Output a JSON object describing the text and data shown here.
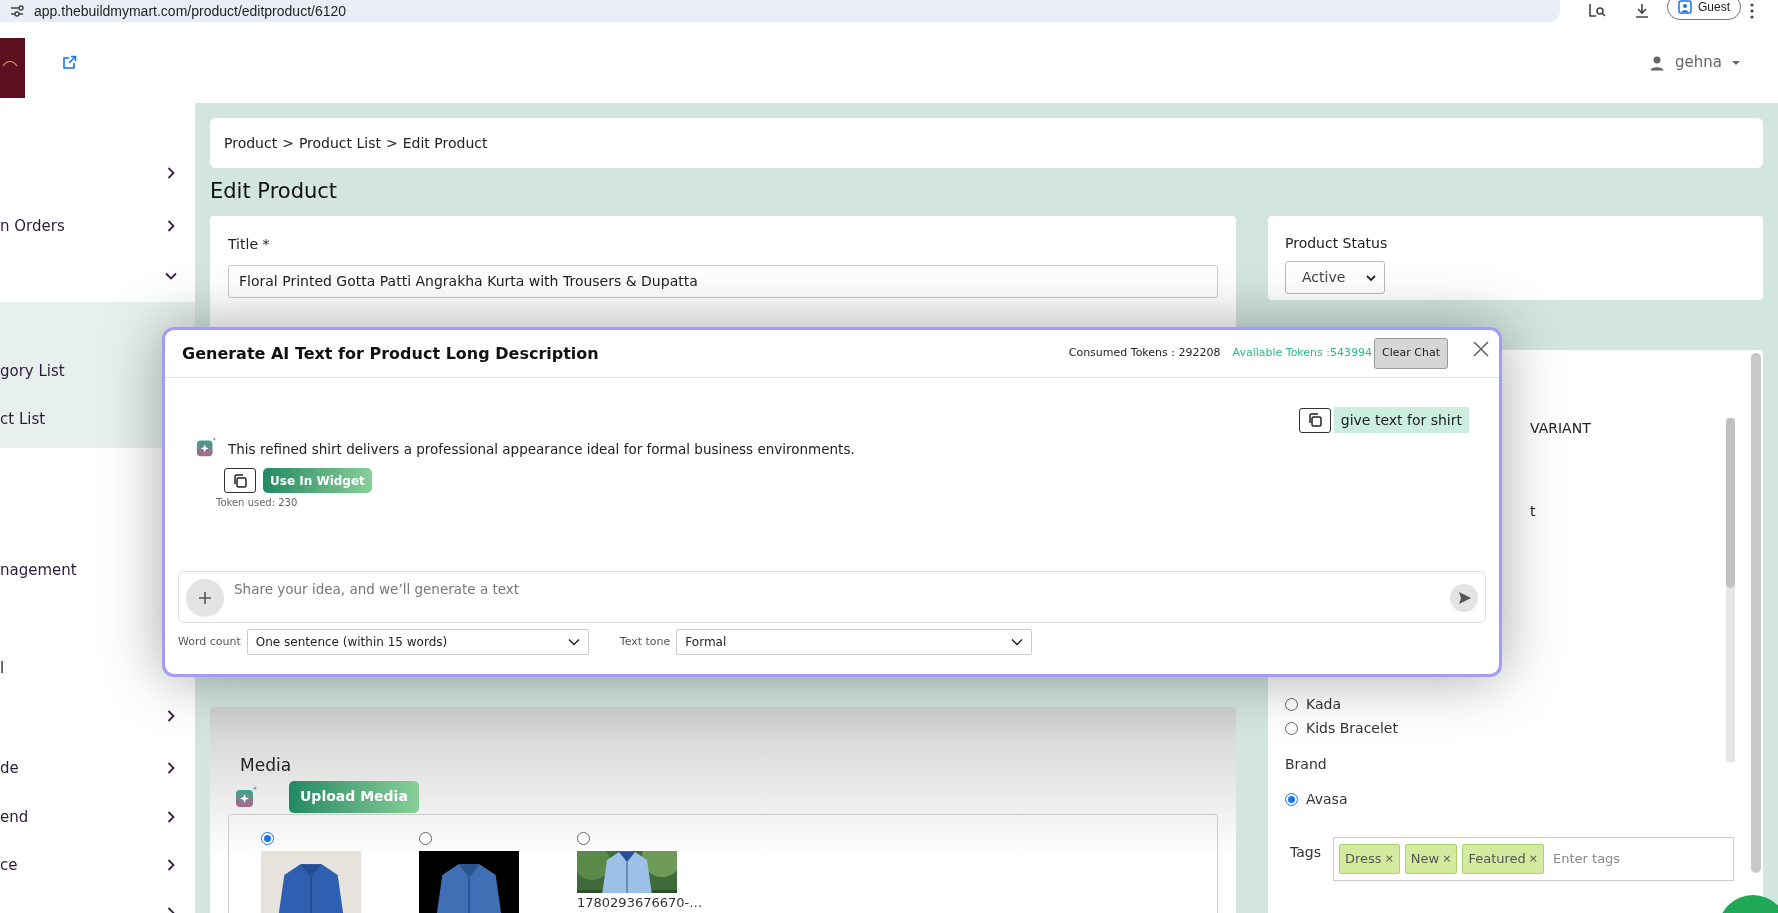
{
  "browser": {
    "url": "app.thebuildmymart.com/product/editproduct/6120",
    "profile": "Guest"
  },
  "header": {
    "user": "gehna"
  },
  "sidebar": {
    "items": [
      {
        "kind": "group",
        "expanded": false
      },
      {
        "kind": "group",
        "label": "n Orders",
        "expanded": false
      },
      {
        "kind": "group",
        "expanded": true,
        "children": [
          {
            "label": "gory List"
          },
          {
            "label": "ct List"
          }
        ]
      },
      {
        "kind": "link",
        "label": "nagement"
      },
      {
        "kind": "link",
        "label": "l"
      },
      {
        "kind": "group",
        "expanded": false
      },
      {
        "kind": "group",
        "label": "de",
        "expanded": false
      },
      {
        "kind": "group",
        "label": "end",
        "expanded": false
      },
      {
        "kind": "group",
        "label": "ce",
        "expanded": false
      },
      {
        "kind": "group",
        "expanded": false
      }
    ]
  },
  "breadcrumb": {
    "items": [
      "Product",
      "Product List",
      "Edit Product"
    ],
    "separator": ">"
  },
  "page_title": "Edit Product",
  "product_form": {
    "title_label": "Title *",
    "title_value": "Floral Printed Gotta Patti Angrakha Kurta with Trousers & Dupatta"
  },
  "status": {
    "label": "Product Status",
    "value": "Active"
  },
  "options_panel": {
    "fragments": [
      "VARIANT",
      "t"
    ],
    "categories": [
      {
        "label": "Kada",
        "selected": false
      },
      {
        "label": "Kids Bracelet",
        "selected": false
      }
    ],
    "brand_label": "Brand",
    "brands": [
      {
        "label": "Avasa",
        "selected": true
      }
    ],
    "tags_label": "Tags",
    "tags": [
      "Dress",
      "New",
      "Featured"
    ],
    "tag_remove": "×",
    "tags_placeholder": "Enter tags"
  },
  "media": {
    "title": "Media",
    "upload_button": "Upload Media",
    "items": [
      {
        "selected": true
      },
      {
        "selected": false
      },
      {
        "selected": false,
        "filename": "1780293676670-…"
      }
    ]
  },
  "ai_dialog": {
    "title": "Generate AI Text for Product Long Description",
    "consumed_tokens": "Consumed Tokens : 292208",
    "available_tokens": "Available Tokens :543994",
    "clear_button": "Clear Chat",
    "messages": [
      {
        "kind": "user",
        "text": "give text for shirt"
      },
      {
        "kind": "assistant",
        "text": "This refined shirt delivers a professional appearance ideal for formal business environments.",
        "action": "Use In Widget",
        "token_usage": "Token used: 230"
      }
    ],
    "prompt_placeholder": "Share your idea, and we’ll generate a text",
    "word_count": {
      "label": "Word count",
      "value": "One sentence (within 15 words)"
    },
    "text_tone": {
      "label": "Text tone",
      "value": "Formal"
    }
  }
}
